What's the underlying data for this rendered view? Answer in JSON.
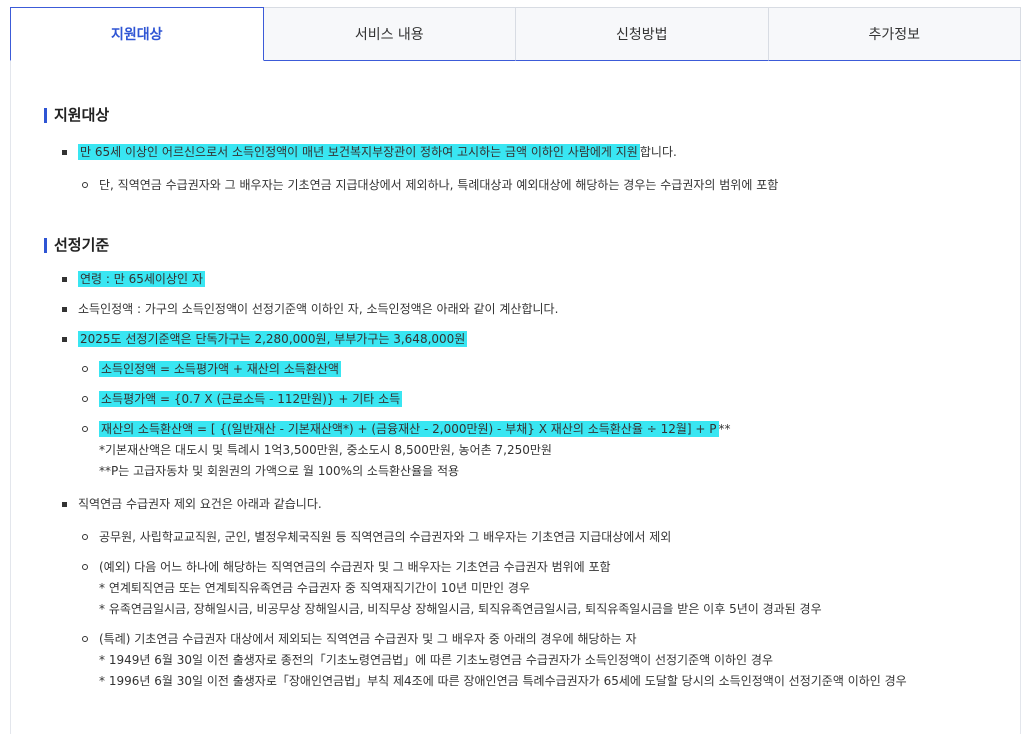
{
  "tabs": [
    "지원대상",
    "서비스 내용",
    "신청방법",
    "추가정보"
  ],
  "section1": {
    "title": "지원대상",
    "item1_highlight": "만 65세 이상인 어르신으로서 소득인정액이 매년 보건복지부장관이 정하여 고시하는 금액 이하인 사람에게 지원",
    "item1_rest": "합니다.",
    "item1_sub": "단, 직역연금 수급권자와 그 배우자는 기초연금 지급대상에서 제외하나, 특례대상과 예외대상에 해당하는 경우는 수급권자의 범위에 포함"
  },
  "section2": {
    "title": "선정기준",
    "age": "연령 : 만 65세이상인 자",
    "income": "소득인정액 : 가구의 소득인정액이 선정기준액 이하인 자, 소득인정액은 아래와 같이 계산합니다.",
    "criteria": "2025도 선정기준액은 단독가구는 2,280,000원, 부부가구는 3,648,000원",
    "formula1": "소득인정액 = 소득평가액 + 재산의 소득환산액",
    "formula2": "소득평가액 = {0.7 X (근로소득 - 112만원)} + 기타 소득",
    "formula3_hl": "재산의 소득환산액 = [ {(일반재산 - 기본재산액*) + (금융재산 - 2,000만원) - 부채} X 재산의 소득환산율 ÷ 12월] + P",
    "formula3_rest": "**",
    "formula3_note1": "*기본재산액은 대도시 및 특례시 1억3,500만원, 중소도시 8,500만원, 농어촌 7,250만원",
    "formula3_note2": "**P는 고급자동차 및 회원권의 가액으로 월 100%의 소득환산율을 적용",
    "occupational": "직역연금 수급권자 제외 요건은 아래과 같습니다.",
    "occ1": "공무원, 사립학교교직원, 군인, 별정우체국직원 등 직역연금의 수급권자와 그 배우자는 기초연금 지급대상에서 제외",
    "occ2": "(예외) 다음 어느 하나에 해당하는 직역연금의 수급권자 및 그 배우자는 기초연금 수급권자 범위에 포함",
    "occ2_note1": "* 연계퇴직연금 또는 연계퇴직유족연금 수급권자 중 직역재직기간이 10년 미만인 경우",
    "occ2_note2": "* 유족연금일시금, 장해일시금, 비공무상 장해일시금, 비직무상 장해일시금, 퇴직유족연금일시금, 퇴직유족일시금을 받은 이후 5년이 경과된 경우",
    "occ3": "(특례) 기초연금 수급권자 대상에서 제외되는 직역연금 수급권자 및 그 배우자 중 아래의 경우에 해당하는 자",
    "occ3_note1": "* 1949년 6월 30일 이전 출생자로 종전의「기초노령연금법」에 따른 기초노령연금 수급권자가 소득인정액이 선정기준액 이하인 경우",
    "occ3_note2": "* 1996년 6월 30일 이전 출생자로「장애인연금법」부칙 제4조에 따른 장애인연금 특례수급권자가 65세에 도달할 당시의 소득인정액이 선정기준액 이하인 경우"
  }
}
